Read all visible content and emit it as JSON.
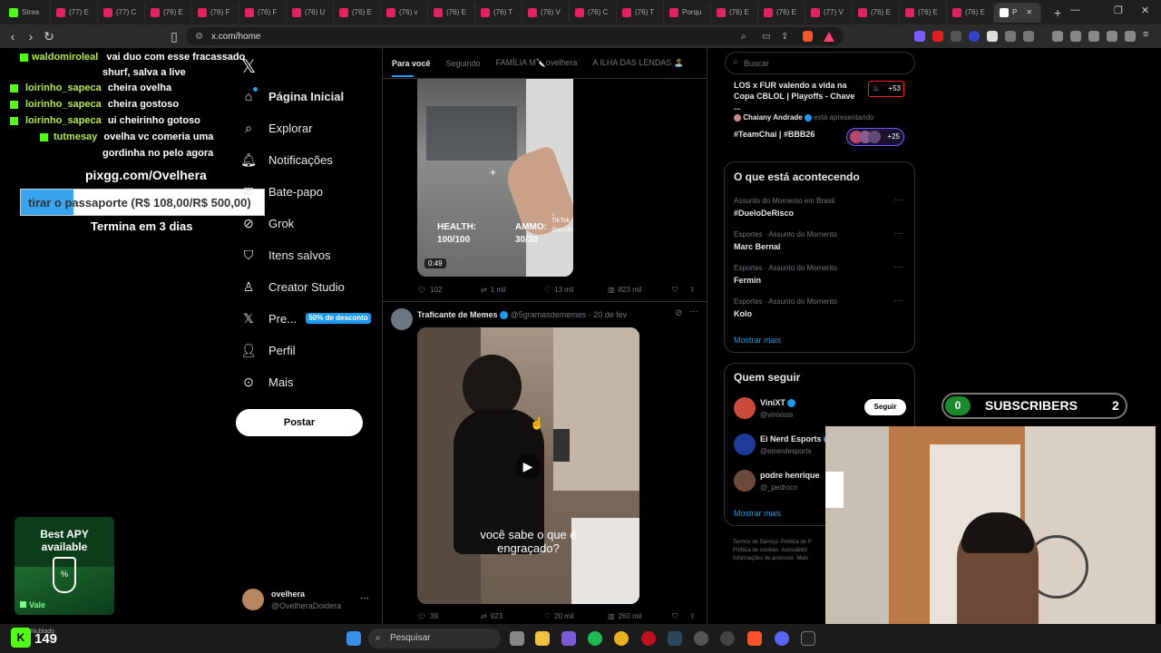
{
  "tabs": [
    {
      "label": "Strea"
    },
    {
      "label": "(77) E"
    },
    {
      "label": "(77) C"
    },
    {
      "label": "(76) E"
    },
    {
      "label": "(76) F"
    },
    {
      "label": "(76) F"
    },
    {
      "label": "(76) U"
    },
    {
      "label": "(76) E"
    },
    {
      "label": "(76) v"
    },
    {
      "label": "(76) E"
    },
    {
      "label": "(76) T"
    },
    {
      "label": "(76) V"
    },
    {
      "label": "(76) C"
    },
    {
      "label": "(76) T"
    },
    {
      "label": "Porqu"
    },
    {
      "label": "(76) E"
    },
    {
      "label": "(76) E"
    },
    {
      "label": "(77) V"
    },
    {
      "label": "(76) E"
    },
    {
      "label": "(76) E"
    },
    {
      "label": "(76) E"
    }
  ],
  "active_tab": "P",
  "url": "x.com/home",
  "chat": [
    {
      "user": "waldomiroleal",
      "msg": "vai duo com esse fracassado",
      "msg2": "shurf, salva a live"
    },
    {
      "user": "loirinho_sapeca",
      "msg": "cheira ovelha"
    },
    {
      "user": "loirinho_sapeca",
      "msg": "cheira gostoso"
    },
    {
      "user": "loirinho_sapeca",
      "msg": "ui cheirinho gotoso"
    },
    {
      "user": "tutmesay",
      "msg": "ovelha vc comeria uma",
      "msg2": "gordinha no pelo agora"
    }
  ],
  "overlay": {
    "link": "pixgg.com/Ovelhera",
    "goal": "tirar o passaporte (R$ 108,00/R$ 500,00)",
    "goal_progress": 0.216,
    "ends": "Termina em 3 dias"
  },
  "apy": {
    "line1": "Best APY",
    "line2": "available",
    "brand": "Vale"
  },
  "kick_count": "149",
  "kick_sub": "Nublado",
  "nav": {
    "home": "Página Inicial",
    "explore": "Explorar",
    "notifications": "Notificações",
    "chat": "Bate-papo",
    "grok": "Grok",
    "bookmarks": "Itens salvos",
    "creator": "Creator Studio",
    "premium": "Pre...",
    "premium_badge": "50% de desconto",
    "profile": "Perfil",
    "more": "Mais",
    "post": "Postar"
  },
  "account": {
    "name": "ovelhera",
    "handle": "@OvelheraDoidera"
  },
  "feed_tabs": [
    "Para você",
    "Seguindo",
    "FAMÍLIA M🔪ovelhera",
    "A ILHA DAS LENDAS 🏝️"
  ],
  "post1": {
    "duration": "0:49",
    "health": "HEALTH:",
    "health_val": "100/100",
    "ammo": "AMMO:",
    "ammo_val": "30/30",
    "tiktok": "TikTok",
    "tiktok_user": "@pcoolo",
    "replies": "102",
    "reposts": "1 mil",
    "likes": "13 mil",
    "views": "823 mil"
  },
  "post2": {
    "author": "Traficante de Memes",
    "handle": "@5gramasdememes",
    "date": "· 20 de fev",
    "caption": "você sabe o que é engraçado?",
    "replies": "39",
    "reposts": "923",
    "likes": "20 mil",
    "views": "260 mil"
  },
  "search_placeholder": "Buscar",
  "live1": {
    "title": "LOS x FUR valendo a vida na Copa CBLOL | Playoffs - Chave ...",
    "count": "+53"
  },
  "live2": {
    "host": "Chaiany Andrade",
    "status": "está apresentando",
    "title": "#TeamChai | #BBB26",
    "count": "+25"
  },
  "happening": {
    "title": "O que está acontecendo",
    "items": [
      {
        "cat": "Assunto do Momento em Brasil",
        "title": "#DueloDeRisco"
      },
      {
        "cat": "Esportes · Assunto do Momento",
        "title": "Marc Bernal"
      },
      {
        "cat": "Esportes · Assunto do Momento",
        "title": "Fermin"
      },
      {
        "cat": "Esportes · Assunto do Momento",
        "title": "Kolo"
      }
    ],
    "show_more": "Mostrar mais"
  },
  "who_follow": {
    "title": "Quem seguir",
    "items": [
      {
        "name": "ViniXT",
        "handle": "@vinixiste"
      },
      {
        "name": "Ei Nerd Esports",
        "handle": "@einerdesports"
      },
      {
        "name": "podre henrique",
        "handle": "@_pedrocn"
      }
    ],
    "follow": "Seguir",
    "show_more": "Mostrar mais"
  },
  "footer": {
    "l1": "Termos de Serviço",
    "l2": "Política de P",
    "l3": "Política de cookies",
    "l4": "Acessibilid",
    "l5": "Informações de anúncios",
    "l6": "Mais"
  },
  "subs": {
    "left": "0",
    "label": "SUBSCRIBERS",
    "right": "2"
  },
  "taskbar": {
    "search": "Pesquisar"
  }
}
